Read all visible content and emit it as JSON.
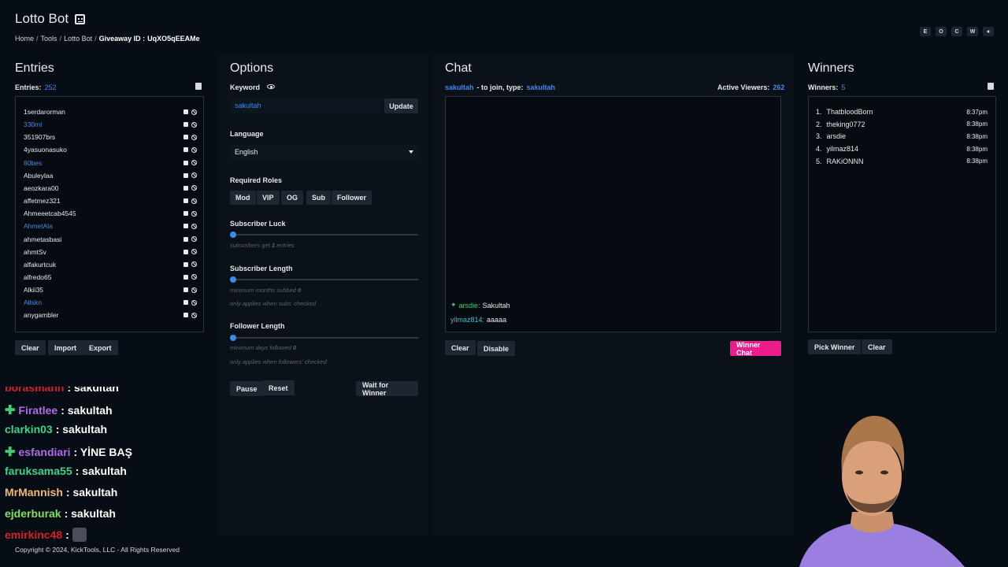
{
  "header": {
    "title": "Lotto Bot",
    "breadcrumb": [
      "Home",
      "Tools",
      "Lotto Bot"
    ],
    "giveaway_label": "Giveaway ID :",
    "giveaway_id": "UqXO5qEEAMe",
    "top_icons": [
      "E",
      "O",
      "C",
      "W",
      "●"
    ]
  },
  "entries": {
    "title": "Entries",
    "count_label": "Entries:",
    "count": "252",
    "list": [
      {
        "name": "1serdarorman",
        "highlight": false
      },
      {
        "name": "330ml",
        "highlight": true
      },
      {
        "name": "351907brs",
        "highlight": false
      },
      {
        "name": "4yasuonasuko",
        "highlight": false
      },
      {
        "name": "80bes",
        "highlight": true
      },
      {
        "name": "Abuleylaa",
        "highlight": false
      },
      {
        "name": "aeozkara00",
        "highlight": false
      },
      {
        "name": "affetmez321",
        "highlight": false
      },
      {
        "name": "Ahmeeetcab4545",
        "highlight": false
      },
      {
        "name": "AhmetAla",
        "highlight": true
      },
      {
        "name": "ahmetasbasi",
        "highlight": false
      },
      {
        "name": "ahmtSv",
        "highlight": false
      },
      {
        "name": "alfakurtcuk",
        "highlight": false
      },
      {
        "name": "alfredo65",
        "highlight": false
      },
      {
        "name": "Alkii35",
        "highlight": false
      },
      {
        "name": "Altskn",
        "highlight": true
      },
      {
        "name": "anygambler",
        "highlight": false
      }
    ],
    "buttons": {
      "clear": "Clear",
      "import": "Import",
      "export": "Export"
    }
  },
  "options": {
    "title": "Options",
    "keyword_label": "Keyword",
    "keyword_value": "sakultah",
    "update_button": "Update",
    "language_label": "Language",
    "language_value": "English",
    "roles_label": "Required Roles",
    "roles": [
      "Mod",
      "VIP",
      "OG",
      "Sub",
      "Follower"
    ],
    "sub_luck_label": "Subscriber Luck",
    "sub_luck_hint_prefix": "subscribers get",
    "sub_luck_value": "1",
    "sub_luck_hint_suffix": "entries",
    "sub_length_label": "Subscriber Length",
    "sub_length_hint": "minimum months subbed",
    "sub_length_value": "0",
    "sub_length_note": "only applies when subs' checked",
    "follower_length_label": "Follower Length",
    "follower_length_hint": "minimum days followed",
    "follower_length_value": "0",
    "follower_length_note": "only applies when followers' checked",
    "pause_button": "Pause",
    "reset_button": "Reset",
    "wait_button": "Wait for Winner"
  },
  "chat": {
    "title": "Chat",
    "join_keyword": "sakultah",
    "join_text": "- to join, type:",
    "active_label": "Active Viewers:",
    "active_count": "262",
    "messages": [
      {
        "user": "arsdie",
        "text": "Sakultah"
      },
      {
        "user": "yilmaz814",
        "text": "aaaaa"
      }
    ],
    "clear_button": "Clear",
    "disable_button": "Disable",
    "winner_chat_button": "Winner Chat"
  },
  "winners": {
    "title": "Winners",
    "count_label": "Winners:",
    "count": "5",
    "list": [
      {
        "rank": "1.",
        "name": "ThatbloodBorn",
        "time": "8:37pm"
      },
      {
        "rank": "2.",
        "name": "theking0772",
        "time": "8:38pm"
      },
      {
        "rank": "3.",
        "name": "arsdie",
        "time": "8:38pm"
      },
      {
        "rank": "4.",
        "name": "yilmaz814",
        "time": "8:38pm"
      },
      {
        "rank": "5.",
        "name": "RAKiONNN",
        "time": "8:38pm"
      }
    ],
    "pick_button": "Pick Winner",
    "clear_button": "Clear"
  },
  "overlay_chat": [
    {
      "user": "borasmann",
      "text": ": sakultah",
      "color": "#d4202a",
      "badge": false
    },
    {
      "user": "Firatlee",
      "text": ": sakultah",
      "color": "#b06ae8",
      "badge": true
    },
    {
      "user": "clarkin03",
      "text": ": sakultah",
      "color": "#3cd48a",
      "badge": false
    },
    {
      "user": "esfandiari",
      "text": ": YİNE BAŞ",
      "color": "#b06ae8",
      "badge": true
    },
    {
      "user": "faruksama55",
      "text": ": sakultah",
      "color": "#3cd48a",
      "badge": false
    },
    {
      "user": "MrMannish",
      "text": ": sakultah",
      "color": "#f0b870",
      "badge": false
    },
    {
      "user": "ejderburak",
      "text": ": sakultah",
      "color": "#7ee05a",
      "badge": false
    },
    {
      "user": "emirkinc48",
      "text": ":",
      "color": "#d4202a",
      "badge": false
    }
  ],
  "footer": "Copyright © 2024, KickTools, LLC - All Rights Reserved"
}
